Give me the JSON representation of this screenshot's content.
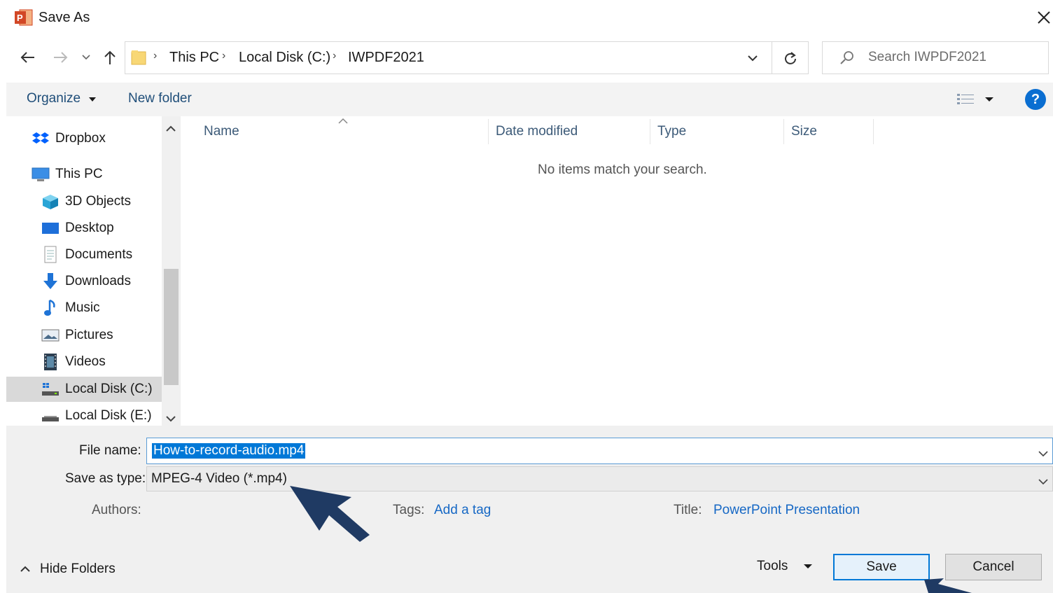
{
  "window": {
    "title": "Save As"
  },
  "address": {
    "crumbs": [
      "This PC",
      "Local Disk (C:)",
      "IWPDF2021"
    ],
    "search_placeholder": "Search IWPDF2021"
  },
  "toolbar": {
    "organize": "Organize",
    "new_folder": "New folder",
    "help": "?"
  },
  "sidebar": {
    "items": [
      {
        "label": "Dropbox",
        "icon": "dropbox-icon"
      },
      {
        "label": "This PC",
        "icon": "pc-icon"
      },
      {
        "label": "3D Objects",
        "icon": "cube-icon"
      },
      {
        "label": "Desktop",
        "icon": "desktop-icon"
      },
      {
        "label": "Documents",
        "icon": "document-icon"
      },
      {
        "label": "Downloads",
        "icon": "download-icon"
      },
      {
        "label": "Music",
        "icon": "music-icon"
      },
      {
        "label": "Pictures",
        "icon": "pictures-icon"
      },
      {
        "label": "Videos",
        "icon": "video-icon"
      },
      {
        "label": "Local Disk (C:)",
        "icon": "drive-icon",
        "selected": true
      },
      {
        "label": "Local Disk (E:)",
        "icon": "drive-icon"
      }
    ]
  },
  "file_list": {
    "columns": [
      "Name",
      "Date modified",
      "Type",
      "Size"
    ],
    "empty_message": "No items match your search."
  },
  "form": {
    "file_name_label": "File name:",
    "file_name_value": "How-to-record-audio.mp4",
    "save_type_label": "Save as type:",
    "save_type_value": "MPEG-4 Video (*.mp4)",
    "authors_label": "Authors:",
    "tags_label": "Tags:",
    "tags_value": "Add a tag",
    "title_label": "Title:",
    "title_value": "PowerPoint Presentation"
  },
  "footer": {
    "hide_folders": "Hide Folders",
    "tools": "Tools",
    "save": "Save",
    "cancel": "Cancel"
  },
  "colors": {
    "accent": "#0078d7",
    "annotation_arrow": "#1f3a63",
    "app_icon": "#d24726"
  }
}
